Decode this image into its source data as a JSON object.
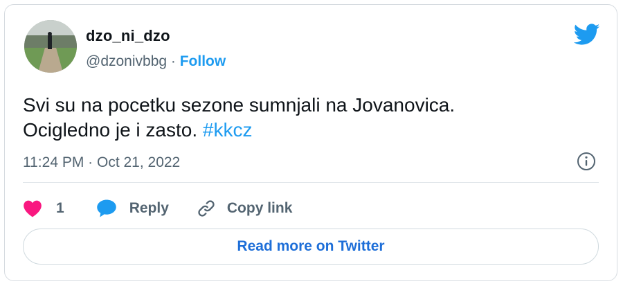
{
  "tweet": {
    "author": {
      "display_name": "dzo_ni_dzo",
      "handle": "@dzonivbbg",
      "separator": " · ",
      "follow_label": "Follow",
      "avatar_icon": "profile-photo"
    },
    "brand_icon": "twitter-bird-icon",
    "text_line1": "Svi su na pocetku sezone sumnjali na Jovanovica.",
    "text_line2": "Ocigledno je i zasto. ",
    "hashtag": "#kkcz",
    "timestamp": "11:24 PM · Oct 21, 2022",
    "info_icon": "info-icon"
  },
  "actions": {
    "like_count": "1",
    "reply_label": "Reply",
    "copy_link_label": "Copy link"
  },
  "read_more_label": "Read more on Twitter",
  "colors": {
    "brand_blue": "#1d9bf0",
    "heart_red": "#f91880",
    "text_primary": "#0f1419",
    "text_secondary": "#536471"
  }
}
